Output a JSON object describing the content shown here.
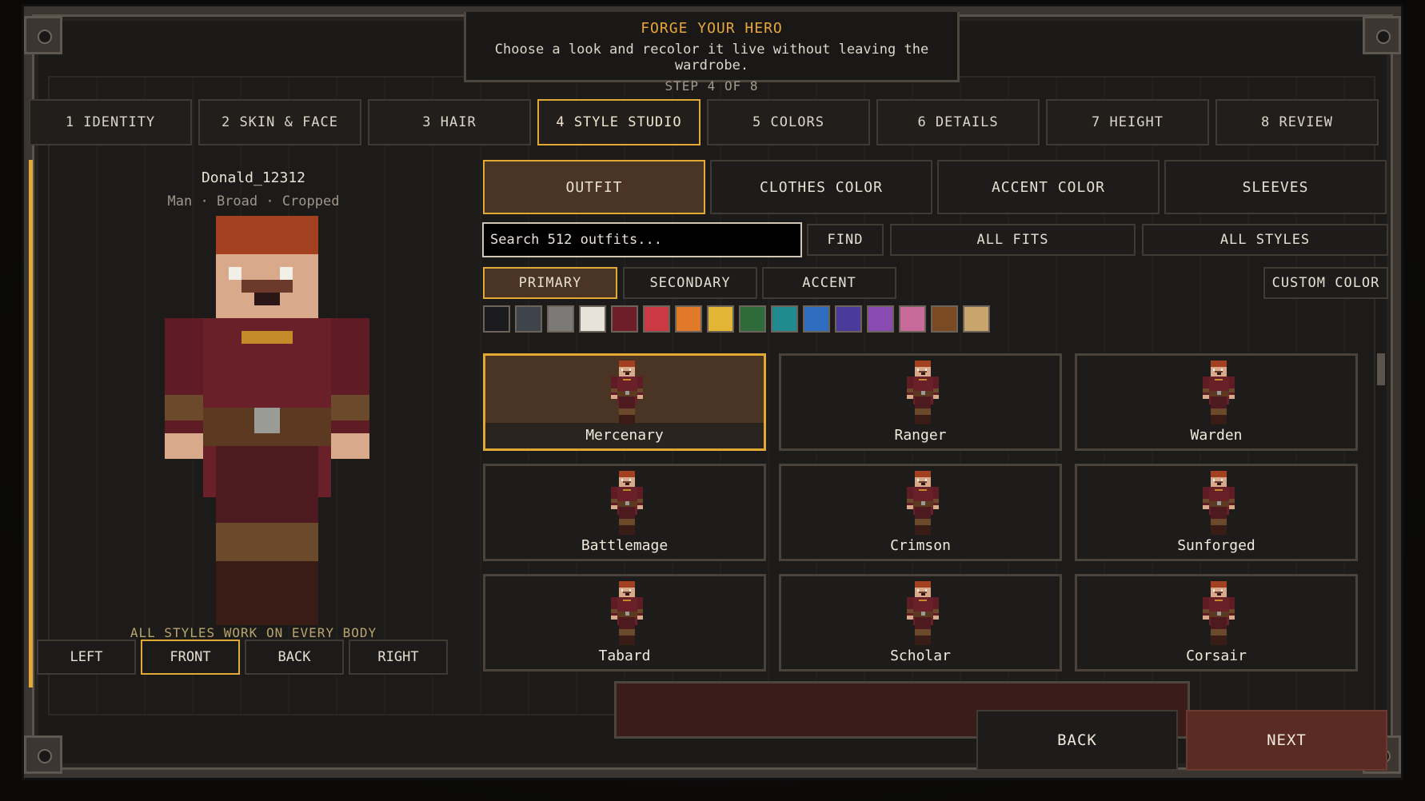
{
  "header": {
    "title": "FORGE YOUR HERO",
    "subtitle": "Choose a look and recolor it live without leaving the wardrobe.",
    "step": "STEP 4 OF 8"
  },
  "steps": [
    {
      "num": "1",
      "label": "IDENTITY"
    },
    {
      "num": "2",
      "label": "SKIN & FACE"
    },
    {
      "num": "3",
      "label": "HAIR"
    },
    {
      "num": "4",
      "label": "STYLE STUDIO"
    },
    {
      "num": "5",
      "label": "COLORS"
    },
    {
      "num": "6",
      "label": "DETAILS"
    },
    {
      "num": "7",
      "label": "HEIGHT"
    },
    {
      "num": "8",
      "label": "REVIEW"
    }
  ],
  "steps_text": [
    "1  IDENTITY",
    "2  SKIN & FACE",
    "3  HAIR",
    "4  STYLE STUDIO",
    "5  COLORS",
    "6  DETAILS",
    "7  HEIGHT",
    "8  REVIEW"
  ],
  "active_step": 4,
  "preview": {
    "name": "Donald_12312",
    "desc": "Man · Broad · Cropped",
    "hint": "ALL STYLES WORK ON EVERY BODY",
    "views": [
      "LEFT",
      "FRONT",
      "BACK",
      "RIGHT"
    ],
    "active_view": "FRONT"
  },
  "subtabs": [
    "OUTFIT",
    "CLOTHES COLOR",
    "ACCENT COLOR",
    "SLEEVES"
  ],
  "active_subtab": "OUTFIT",
  "search": {
    "placeholder": "Search 512 outfits...",
    "find": "FIND"
  },
  "filters": {
    "fits": "ALL FITS",
    "styles": "ALL STYLES"
  },
  "color_slots": [
    "PRIMARY",
    "SECONDARY",
    "ACCENT"
  ],
  "active_slot": "PRIMARY",
  "custom_color": "CUSTOM COLOR",
  "swatches": [
    "#1b1b1d",
    "#3f434c",
    "#7c7a77",
    "#e7e3db",
    "#6e1e29",
    "#c93a45",
    "#e07a2a",
    "#e2b537",
    "#2f6b3a",
    "#218a8e",
    "#2e6cc0",
    "#4a3b9a",
    "#8a4bb0",
    "#c86a9a",
    "#7a4a24",
    "#c9a56e"
  ],
  "outfits": [
    "Mercenary",
    "Ranger",
    "Warden",
    "Battlemage",
    "Crimson",
    "Sunforged",
    "Tabard",
    "Scholar",
    "Corsair"
  ],
  "active_outfit": "Mercenary",
  "nav": {
    "back": "BACK",
    "next": "NEXT"
  },
  "colors": {
    "accent": "#e2aa34",
    "outfit": "#6b1f24",
    "hair": "#a3401f",
    "skin": "#d9a98c"
  }
}
